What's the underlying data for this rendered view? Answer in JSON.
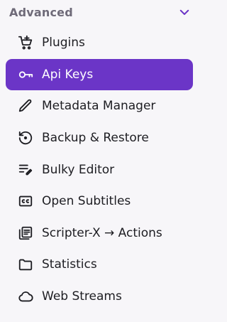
{
  "section": {
    "title": "Advanced",
    "chevron_icon": "chevron-down-icon",
    "accent_color": "#6b35c7"
  },
  "menu": {
    "items": [
      {
        "label": "Plugins",
        "icon": "cart-plus-icon"
      },
      {
        "label": "Api Keys",
        "icon": "key-icon",
        "active": true
      },
      {
        "label": "Metadata Manager",
        "icon": "pencil-icon"
      },
      {
        "label": "Backup & Restore",
        "icon": "restore-icon"
      },
      {
        "label": "Bulky Editor",
        "icon": "bulk-edit-icon"
      },
      {
        "label": "Open Subtitles",
        "icon": "closed-caption-icon"
      },
      {
        "label": "Scripter-X → Actions",
        "icon": "script-list-icon"
      },
      {
        "label": "Statistics",
        "icon": "folder-icon"
      },
      {
        "label": "Web Streams",
        "icon": "cloud-icon"
      }
    ]
  }
}
